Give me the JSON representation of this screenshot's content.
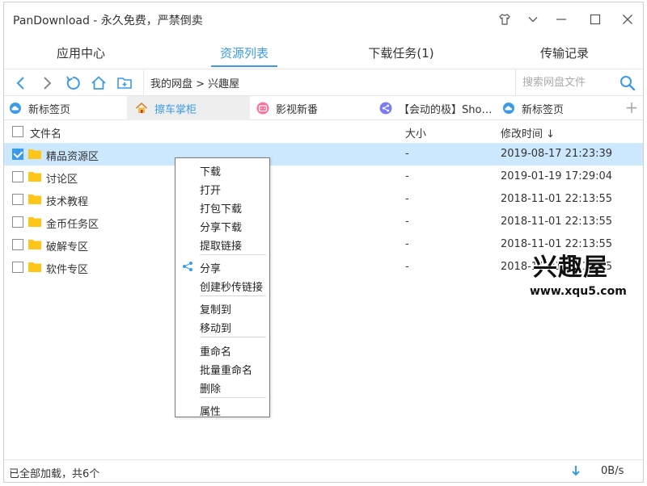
{
  "window": {
    "title": "PanDownload - 永久免费，严禁倒卖"
  },
  "nav_tabs": [
    {
      "label": "应用中心"
    },
    {
      "label": "资源列表"
    },
    {
      "label": "下载任务(1)"
    },
    {
      "label": "传输记录"
    }
  ],
  "toolbar": {
    "breadcrumb": "我的网盘 > 兴趣屋",
    "search_placeholder": "搜索网盘文件"
  },
  "browser_tabs": [
    {
      "label": "新标签页",
      "icon": "cloud-icon"
    },
    {
      "label": "擦车掌柜",
      "icon": "home-icon"
    },
    {
      "label": "影视新番",
      "icon": "bilibili-icon"
    },
    {
      "label": "【会动的极】Sho…",
      "icon": "share-icon"
    },
    {
      "label": "新标签页",
      "icon": "cloud-icon"
    }
  ],
  "list": {
    "headers": {
      "name": "文件名",
      "size": "大小",
      "date": "修改时间 ↓"
    },
    "rows": [
      {
        "name": "精品资源区",
        "size": "-",
        "date": "2019-08-17 21:23:39",
        "checked": true
      },
      {
        "name": "讨论区",
        "size": "-",
        "date": "2019-01-19 17:29:04",
        "checked": false
      },
      {
        "name": "技术教程",
        "size": "-",
        "date": "2018-11-01 22:13:55",
        "checked": false
      },
      {
        "name": "金币任务区",
        "size": "-",
        "date": "2018-11-01 22:13:55",
        "checked": false
      },
      {
        "name": "破解专区",
        "size": "-",
        "date": "2018-11-01 22:13:55",
        "checked": false
      },
      {
        "name": "软件专区",
        "size": "-",
        "date": "2018-11-01 22:13:55",
        "checked": false
      }
    ]
  },
  "context_menu": {
    "items": [
      {
        "label": "下载"
      },
      {
        "label": "打开"
      },
      {
        "label": "打包下载"
      },
      {
        "label": "分享下载"
      },
      {
        "label": "提取链接"
      },
      {
        "label": "分享",
        "icon": "share-icon"
      },
      {
        "label": "创建秒传链接"
      },
      {
        "label": "复制到"
      },
      {
        "label": "移动到"
      },
      {
        "label": "重命名"
      },
      {
        "label": "批量重命名"
      },
      {
        "label": "删除"
      },
      {
        "label": "属性"
      }
    ]
  },
  "watermark": {
    "big": "兴趣屋",
    "small": "www.xqu5.com"
  },
  "status": {
    "text": "已全部加载，共6个",
    "speed": "0B/s"
  },
  "colors": {
    "accent": "#3b9be8",
    "selected_row": "#cce8ff",
    "folder": "#ffc61a"
  }
}
